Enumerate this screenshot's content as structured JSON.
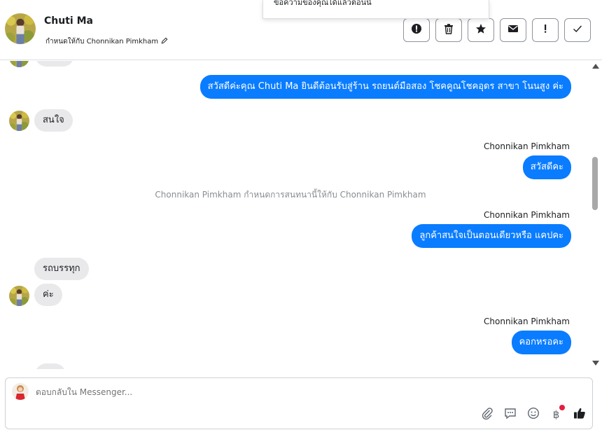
{
  "header": {
    "contact_name": "Chuti Ma",
    "assigned_text": "กำหนดให้กับ Chonnikan Pimkham",
    "actions": [
      {
        "icon": "alert-circle-icon",
        "name": "spam-button"
      },
      {
        "icon": "trash-icon",
        "name": "delete-button"
      },
      {
        "icon": "star-icon",
        "name": "star-button"
      },
      {
        "icon": "envelope-icon",
        "name": "mark-unread-button"
      },
      {
        "icon": "exclamation-icon",
        "name": "follow-up-button"
      },
      {
        "icon": "check-icon",
        "name": "mark-done-button"
      }
    ]
  },
  "toast": {
    "text": "ข้อความของคุณได้แล้วตอนนี้"
  },
  "messages": {
    "m1": "สวัสดีค่ะคุณ Chuti Ma ยินดีต้อนรับสู่ร้าน รถยนต์มือสอง โชคคูณโชคอุดร สาขา โนนสูง ค่ะ",
    "m2": "สนใจ",
    "m3_sender": "Chonnikan Pimkham",
    "m3": "สวัสดีคะ",
    "system": "Chonnikan Pimkham กำหนดการสนทนานี้ให้กับ Chonnikan Pimkham",
    "m4_sender": "Chonnikan Pimkham",
    "m4": "ลูกค้าสนใจเป็นตอนเดียวหรือ แคปคะ",
    "m5": "รถบรรทุก",
    "m6": "ค่ะ",
    "m7_sender": "Chonnikan Pimkham",
    "m7": "คอกหรอคะ"
  },
  "composer": {
    "placeholder": "ตอบกลับใน Messenger...",
    "tools": [
      "paperclip-icon",
      "chat-bubble-icon",
      "smiley-icon",
      "baht-icon",
      "thumbs-up-icon"
    ],
    "baht_symbol": "฿"
  },
  "colors": {
    "outgoing_bubble": "#0a7cff",
    "incoming_bubble": "#e9e9eb",
    "notification_dot": "#e41e3f"
  }
}
